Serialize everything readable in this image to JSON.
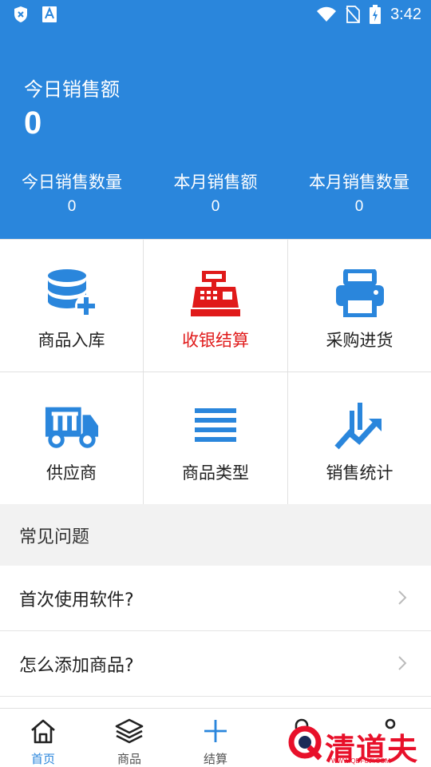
{
  "status_bar": {
    "time": "3:42",
    "left_icons": [
      "shield-x-icon",
      "font-a-icon"
    ],
    "right_icons": [
      "wifi-icon",
      "no-sim-icon",
      "battery-charging-icon"
    ]
  },
  "header": {
    "title": "今日销售额",
    "value": "0",
    "stats": [
      {
        "label": "今日销售数量",
        "value": "0"
      },
      {
        "label": "本月销售额",
        "value": "0"
      },
      {
        "label": "本月销售数量",
        "value": "0"
      }
    ],
    "bg_color": "#2a86dc"
  },
  "grid": [
    {
      "label": "商品入库",
      "icon": "database-plus-icon"
    },
    {
      "label": "收银结算",
      "icon": "cash-register-icon",
      "highlight": "#e01a1a"
    },
    {
      "label": "采购进货",
      "icon": "printer-icon"
    },
    {
      "label": "供应商",
      "icon": "truck-icon"
    },
    {
      "label": "商品类型",
      "icon": "list-lines-icon"
    },
    {
      "label": "销售统计",
      "icon": "trend-chart-icon"
    }
  ],
  "faq": {
    "title": "常见问题",
    "items": [
      {
        "label": "首次使用软件?"
      },
      {
        "label": "怎么添加商品?"
      }
    ]
  },
  "tabbar": {
    "tabs": [
      {
        "label": "首页",
        "icon": "home-icon",
        "active": true
      },
      {
        "label": "商品",
        "icon": "layers-icon"
      },
      {
        "label": "结算",
        "icon": "plus-icon"
      },
      {
        "label": "",
        "icon": "bag-icon"
      },
      {
        "label": "",
        "icon": "user-icon"
      }
    ]
  },
  "watermark": {
    "text": "清道夫",
    "sub": "WWW.QDFUJI.COM"
  }
}
